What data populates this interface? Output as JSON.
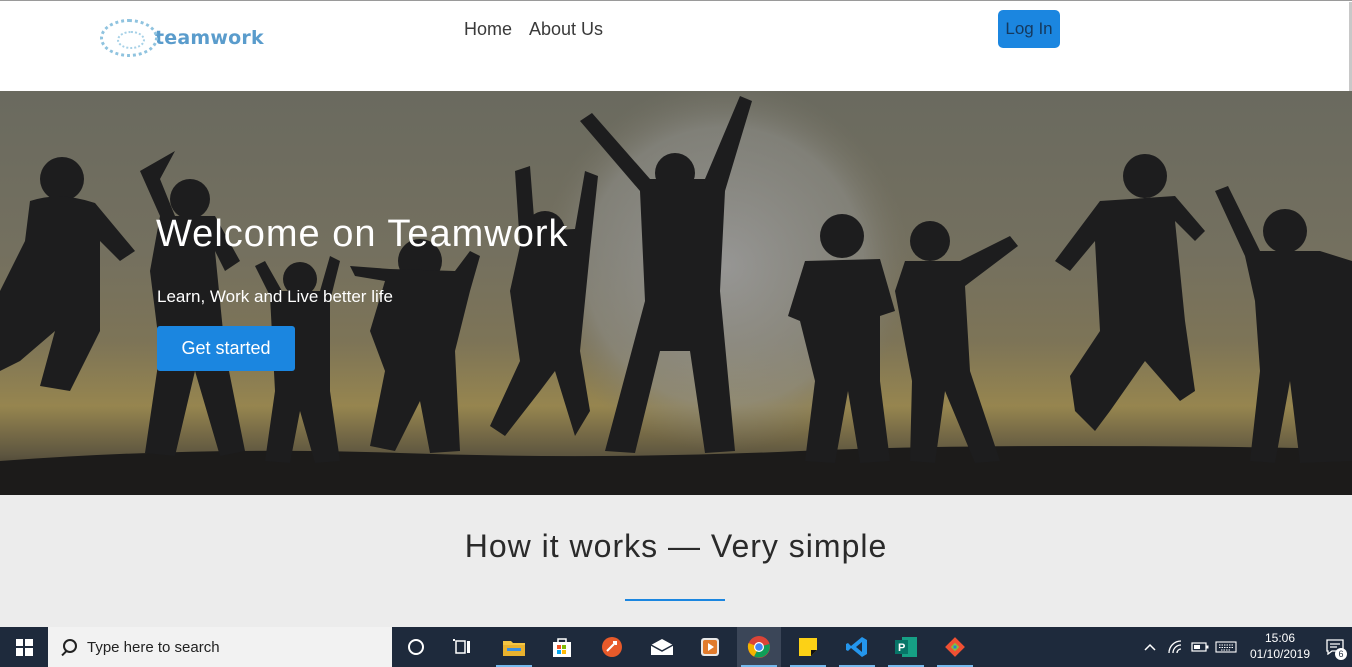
{
  "navbar": {
    "logo_text": "teamwork",
    "links": [
      {
        "label": "Home"
      },
      {
        "label": "About Us"
      }
    ],
    "login_label": "Log In"
  },
  "hero": {
    "title": "Welcome on Teamwork",
    "subtitle": "Learn, Work and Live better life",
    "cta_label": "Get started"
  },
  "how": {
    "title": "How it works — Very simple"
  },
  "taskbar": {
    "search_placeholder": "Type here to search",
    "time": "15:06",
    "date": "01/10/2019",
    "notification_count": "6",
    "pinned_icons": [
      "cortana-icon",
      "task-view-icon",
      "file-explorer-icon",
      "store-icon",
      "app-icon",
      "mail-icon",
      "media-icon",
      "chrome-icon",
      "sticky-notes-icon",
      "vscode-icon",
      "publisher-icon",
      "git-icon"
    ]
  },
  "colors": {
    "accent_blue": "#1b86e0",
    "taskbar": "#1e2a3c",
    "section_bg": "#ececec",
    "logo_blue": "#5a9ccc"
  }
}
